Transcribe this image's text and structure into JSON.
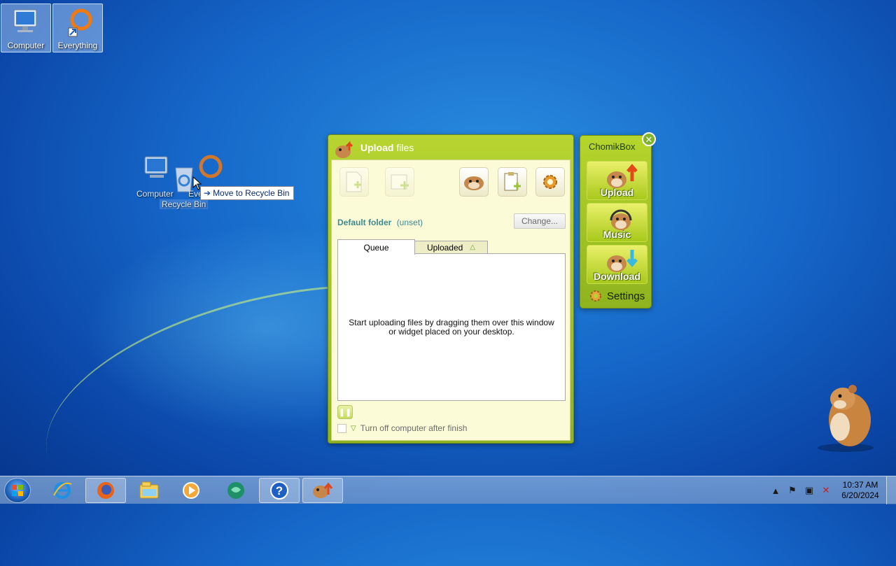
{
  "desktop": {
    "icons": [
      {
        "label": "Computer",
        "icon": "computer-icon"
      },
      {
        "label": "Everything",
        "icon": "everything-search-icon"
      }
    ],
    "drag": {
      "ghost_labels": [
        "Computer",
        "Eve",
        "Recycle Bin"
      ],
      "tooltip": "Move to Recycle Bin"
    }
  },
  "upload_window": {
    "title_bold": "Upload",
    "title_rest": " files",
    "toolbar": [
      "add-file-icon",
      "add-folder-icon",
      "hamster-icon",
      "clipboard-add-icon",
      "gear-icon"
    ],
    "default_folder_label": "Default folder",
    "default_folder_value": "(unset)",
    "change_label": "Change...",
    "tabs": {
      "queue": "Queue",
      "uploaded": "Uploaded"
    },
    "empty_message": "Start uploading files by dragging them over this window or widget placed on your desktop.",
    "shutdown_label": "Turn off computer after finish",
    "accent": "#9bbf22"
  },
  "chomikbox": {
    "title": "ChomikBox",
    "buttons": [
      "Upload",
      "Music",
      "Download"
    ],
    "settings": "Settings"
  },
  "taskbar": {
    "items": [
      "internet-explorer-icon",
      "firefox-icon",
      "file-explorer-icon",
      "media-player-icon",
      "chat-app-icon",
      "help-icon",
      "chomikbox-icon"
    ],
    "time": "10:37 AM",
    "date": "6/20/2024"
  }
}
